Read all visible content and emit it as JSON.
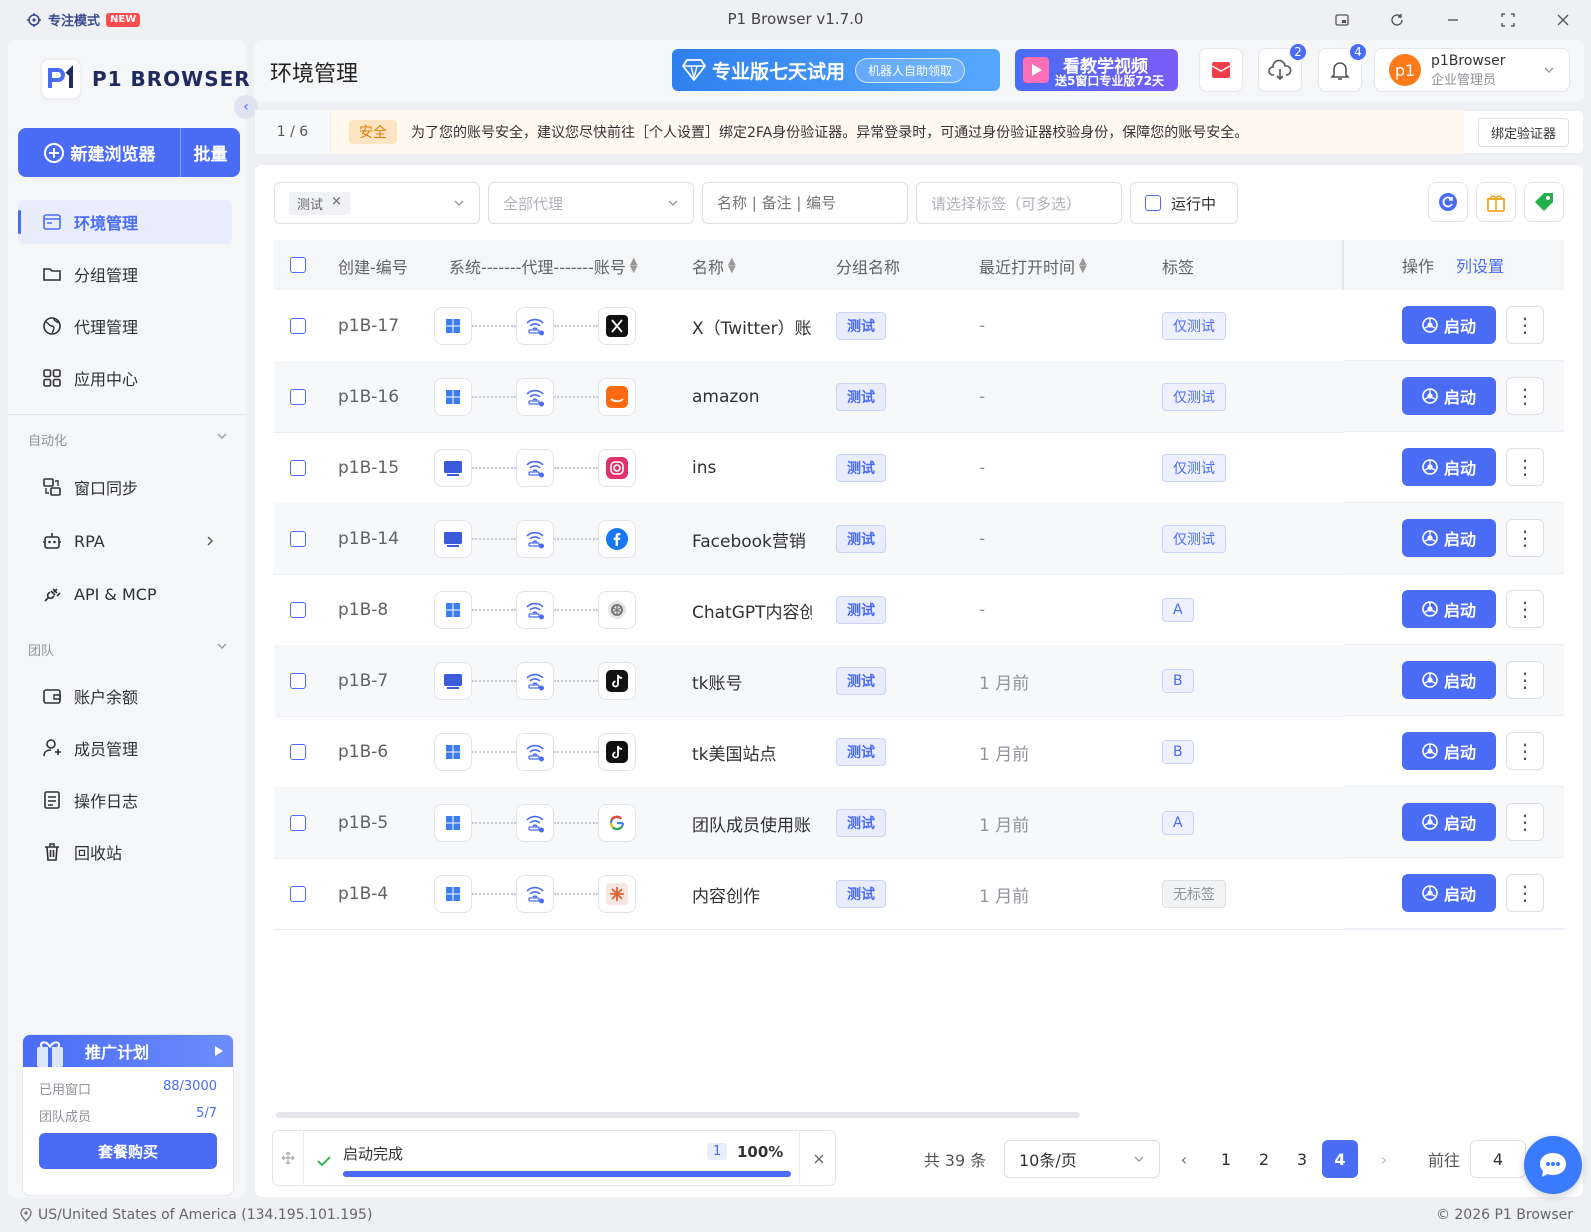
{
  "titlebar": {
    "focus_mode": "专注模式",
    "new_badge": "NEW",
    "app_title": "P1 Browser v1.7.0"
  },
  "sidebar": {
    "logo": "P1 BROWSER",
    "new_browser": "新建浏览器",
    "batch": "批量",
    "nav": [
      {
        "label": "环境管理",
        "icon": "browser-window-icon"
      },
      {
        "label": "分组管理",
        "icon": "folder-icon"
      },
      {
        "label": "代理管理",
        "icon": "globe-icon"
      },
      {
        "label": "应用中心",
        "icon": "apps-grid-icon"
      }
    ],
    "section_automation": "自动化",
    "automation": [
      {
        "label": "窗口同步",
        "icon": "window-sync-icon"
      },
      {
        "label": "RPA",
        "icon": "robot-icon"
      },
      {
        "label": "API & MCP",
        "icon": "plug-icon"
      }
    ],
    "section_team": "团队",
    "team": [
      {
        "label": "账户余额",
        "icon": "wallet-icon"
      },
      {
        "label": "成员管理",
        "icon": "member-icon"
      },
      {
        "label": "操作日志",
        "icon": "log-icon"
      },
      {
        "label": "回收站",
        "icon": "trash-icon"
      }
    ],
    "promo": {
      "title": "推广计划",
      "used_windows_label": "已用窗口",
      "used_windows": "88/3000",
      "team_members_label": "团队成员",
      "team_members": "5/7",
      "buy": "套餐购买"
    }
  },
  "header": {
    "title": "环境管理",
    "banner_trial": "专业版七天试用",
    "banner_trial_pill": "机器人自助领取",
    "banner_video_title": "看教学视频",
    "banner_video_sub": "送5窗口专业版72天",
    "download_badge": "2",
    "notify_badge": "4",
    "user_avatar": "p1",
    "user_name": "p1Browser",
    "user_role": "企业管理员"
  },
  "notice": {
    "page": "1 / 6",
    "tag": "安全",
    "text": "为了您的账号安全，建议您尽快前往［个人设置］绑定2FA身份验证器。异常登录时，可通过身份验证器校验身份，保障您的账号安全。",
    "bind": "绑定验证器"
  },
  "filters": {
    "group_tag": "测试",
    "proxy": "全部代理",
    "search_placeholder": "名称 | 备注 | 编号",
    "tags_placeholder": "请选择标签（可多选）",
    "running": "运行中"
  },
  "table": {
    "headers": {
      "id": "创建-编号",
      "sys": "系统-------代理-------账号",
      "name": "名称",
      "group": "分组名称",
      "last_open": "最近打开时间",
      "tag": "标签",
      "ops": "操作",
      "col_setting": "列设置"
    },
    "start_label": "启动",
    "rows": [
      {
        "id": "p1B-17",
        "os": "windows",
        "platform": "x",
        "name": "X（Twitter）账",
        "group": "测试",
        "last": "-",
        "tag": "仅测试",
        "tag_style": "blue"
      },
      {
        "id": "p1B-16",
        "os": "windows",
        "platform": "amazon",
        "name": "amazon",
        "group": "测试",
        "last": "-",
        "tag": "仅测试",
        "tag_style": "blue"
      },
      {
        "id": "p1B-15",
        "os": "mac",
        "platform": "instagram",
        "name": "ins",
        "group": "测试",
        "last": "-",
        "tag": "仅测试",
        "tag_style": "blue"
      },
      {
        "id": "p1B-14",
        "os": "mac",
        "platform": "facebook",
        "name": "Facebook营销",
        "group": "测试",
        "last": "-",
        "tag": "仅测试",
        "tag_style": "blue"
      },
      {
        "id": "p1B-8",
        "os": "windows",
        "platform": "chatgpt",
        "name": "ChatGPT内容创",
        "group": "测试",
        "last": "-",
        "tag": "A",
        "tag_style": "blue"
      },
      {
        "id": "p1B-7",
        "os": "mac",
        "platform": "tiktok",
        "name": "tk账号",
        "group": "测试",
        "last": "1 月前",
        "tag": "B",
        "tag_style": "blue"
      },
      {
        "id": "p1B-6",
        "os": "windows",
        "platform": "tiktok",
        "name": "tk美国站点",
        "group": "测试",
        "last": "1 月前",
        "tag": "B",
        "tag_style": "blue"
      },
      {
        "id": "p1B-5",
        "os": "windows",
        "platform": "google",
        "name": "团队成员使用账",
        "group": "测试",
        "last": "1 月前",
        "tag": "A",
        "tag_style": "blue"
      },
      {
        "id": "p1B-4",
        "os": "windows",
        "platform": "claude",
        "name": "内容创作",
        "group": "测试",
        "last": "1 月前",
        "tag": "无标签",
        "tag_style": "none"
      }
    ]
  },
  "progress": {
    "label": "启动完成",
    "count": "1",
    "percent": "100%",
    "fraction": 1.0
  },
  "pagination": {
    "total": "共 39 条",
    "page_size": "10条/页",
    "pages": [
      "1",
      "2",
      "3",
      "4"
    ],
    "current": "4",
    "goto_label": "前往",
    "goto_value": "4"
  },
  "status": {
    "location": "US/United States of America (134.195.101.195)",
    "copyright": "© 2026 P1 Browser"
  },
  "colors": {
    "accent": "#4a6cf7",
    "avatar": "#ff7a1a",
    "safe_tag": "#e07b00"
  }
}
